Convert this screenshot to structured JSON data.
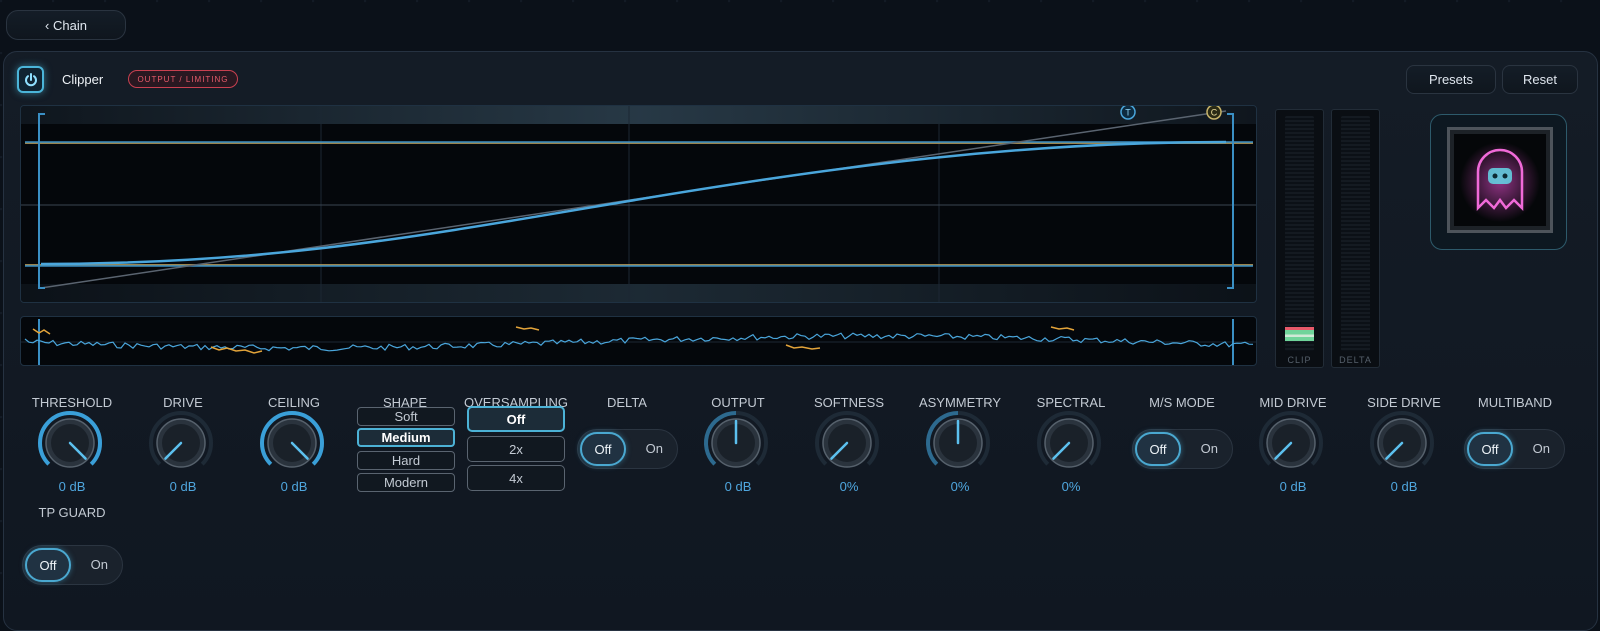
{
  "nav": {
    "back_label": "‹ Chain"
  },
  "header": {
    "title": "Clipper",
    "badge": "OUTPUT / LIMITING",
    "presets_label": "Presets",
    "reset_label": "Reset"
  },
  "graph": {
    "threshold_marker": "T",
    "ceiling_marker": "C"
  },
  "meters": {
    "clip_label": "CLIP",
    "delta_label": "DELTA"
  },
  "controls": {
    "threshold": {
      "label": "THRESHOLD",
      "value": "0 dB",
      "level": 1.0
    },
    "drive": {
      "label": "DRIVE",
      "value": "0 dB",
      "level": 0.0
    },
    "ceiling": {
      "label": "CEILING",
      "value": "0 dB",
      "level": 1.0
    },
    "shape": {
      "label": "SHAPE",
      "options": [
        "Soft",
        "Medium",
        "Hard",
        "Modern"
      ],
      "selected": "Medium"
    },
    "oversampling": {
      "label": "OVERSAMPLING",
      "options": [
        "Off",
        "2x",
        "4x"
      ],
      "selected": "Off"
    },
    "delta": {
      "label": "DELTA",
      "off": "Off",
      "on": "On"
    },
    "output": {
      "label": "OUTPUT",
      "value": "0 dB",
      "level": 0.5
    },
    "softness": {
      "label": "SOFTNESS",
      "value": "0%",
      "level": 0.0
    },
    "asymmetry": {
      "label": "ASYMMETRY",
      "value": "0%",
      "level": 0.5
    },
    "spectral": {
      "label": "SPECTRAL",
      "value": "0%",
      "level": 0.0
    },
    "ms_mode": {
      "label": "M/S MODE",
      "off": "Off",
      "on": "On"
    },
    "mid_drive": {
      "label": "MID DRIVE",
      "value": "0 dB",
      "level": 0.0
    },
    "side_drive": {
      "label": "SIDE DRIVE",
      "value": "0 dB",
      "level": 0.0
    },
    "multiband": {
      "label": "MULTIBAND",
      "off": "Off",
      "on": "On"
    },
    "tp_guard": {
      "label": "TP GUARD",
      "off": "Off",
      "on": "On"
    }
  },
  "colors": {
    "accent": "#4fa6de",
    "threshold_line": "#b59a5a",
    "badge": "#e65a6a"
  }
}
